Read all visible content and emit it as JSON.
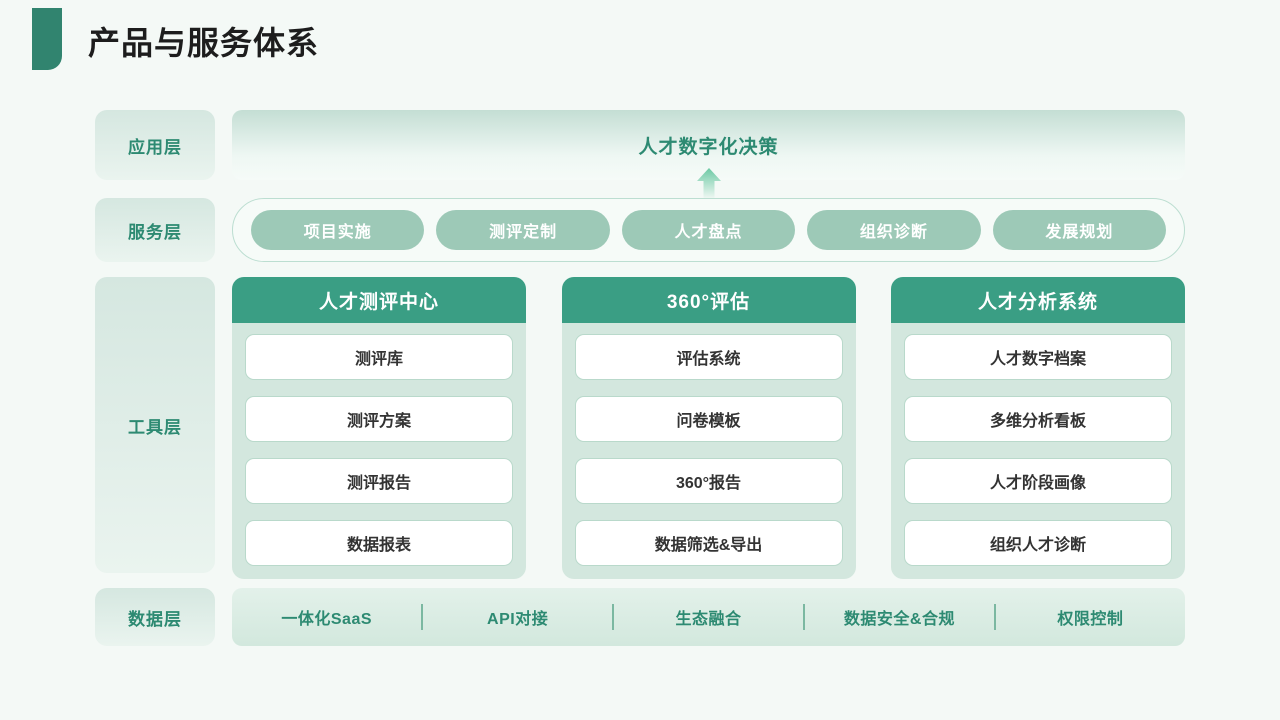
{
  "header": {
    "title": "产品与服务体系",
    "accent_color": "#31846f"
  },
  "colors": {
    "page_background": "#f4f9f6",
    "brand_green": "#3a9e84",
    "label_green": "#2d8a72",
    "pill_green": "#9dc9b7",
    "card_body": "#d3e7de"
  },
  "layers": {
    "application": {
      "label": "应用层",
      "banner_text": "人才数字化决策",
      "arrow_icon": "arrow-up-icon"
    },
    "service": {
      "label": "服务层",
      "pills": [
        {
          "label": "项目实施"
        },
        {
          "label": "测评定制"
        },
        {
          "label": "人才盘点"
        },
        {
          "label": "组织诊断"
        },
        {
          "label": "发展规划"
        }
      ]
    },
    "tools": {
      "label": "工具层",
      "cards": [
        {
          "title": "人才测评中心",
          "items": [
            {
              "label": "测评库"
            },
            {
              "label": "测评方案"
            },
            {
              "label": "测评报告"
            },
            {
              "label": "数据报表"
            }
          ]
        },
        {
          "title": "360°评估",
          "items": [
            {
              "label": "评估系统"
            },
            {
              "label": "问卷模板"
            },
            {
              "label": "360°报告"
            },
            {
              "label": "数据筛选&导出"
            }
          ]
        },
        {
          "title": "人才分析系统",
          "items": [
            {
              "label": "人才数字档案"
            },
            {
              "label": "多维分析看板"
            },
            {
              "label": "人才阶段画像"
            },
            {
              "label": "组织人才诊断"
            }
          ]
        }
      ]
    },
    "data": {
      "label": "数据层",
      "items": [
        {
          "label": "一体化SaaS"
        },
        {
          "label": "API对接"
        },
        {
          "label": "生态融合"
        },
        {
          "label": "数据安全&合规"
        },
        {
          "label": "权限控制"
        }
      ]
    }
  }
}
